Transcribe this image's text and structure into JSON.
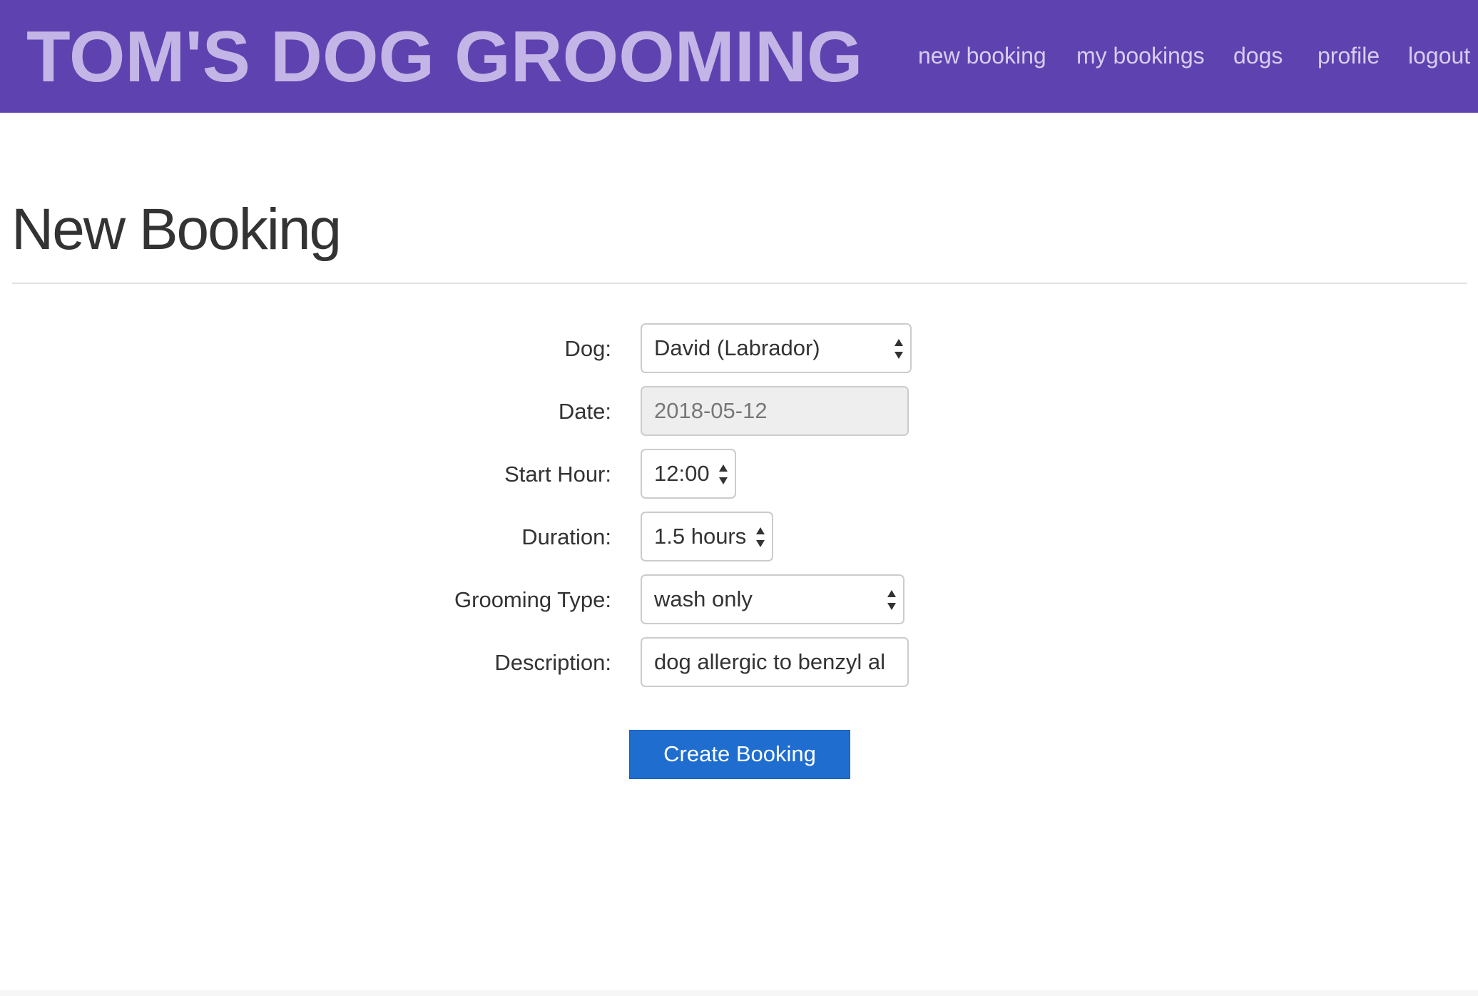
{
  "header": {
    "brand": "TOM'S DOG GROOMING",
    "nav": [
      {
        "label": "new booking"
      },
      {
        "label": "my bookings"
      },
      {
        "label": "dogs"
      },
      {
        "label": "profile"
      },
      {
        "label": "logout"
      }
    ]
  },
  "main": {
    "title": "New Booking",
    "form": {
      "dog": {
        "label": "Dog:",
        "value": "David (Labrador)"
      },
      "date": {
        "label": "Date:",
        "value": "2018-05-12"
      },
      "start_hour": {
        "label": "Start Hour:",
        "value": "12:00"
      },
      "duration": {
        "label": "Duration:",
        "value": "1.5 hours"
      },
      "grooming_type": {
        "label": "Grooming Type:",
        "value": "wash only"
      },
      "description": {
        "label": "Description:",
        "value": "dog allergic to benzyl al"
      }
    },
    "submit_label": "Create Booking"
  },
  "colors": {
    "header_bg": "#5e43b0",
    "brand_text": "#c3b6e6",
    "nav_text": "#d6cdef",
    "button_bg": "#1f6dcf",
    "disabled_bg": "#eeeeee"
  }
}
